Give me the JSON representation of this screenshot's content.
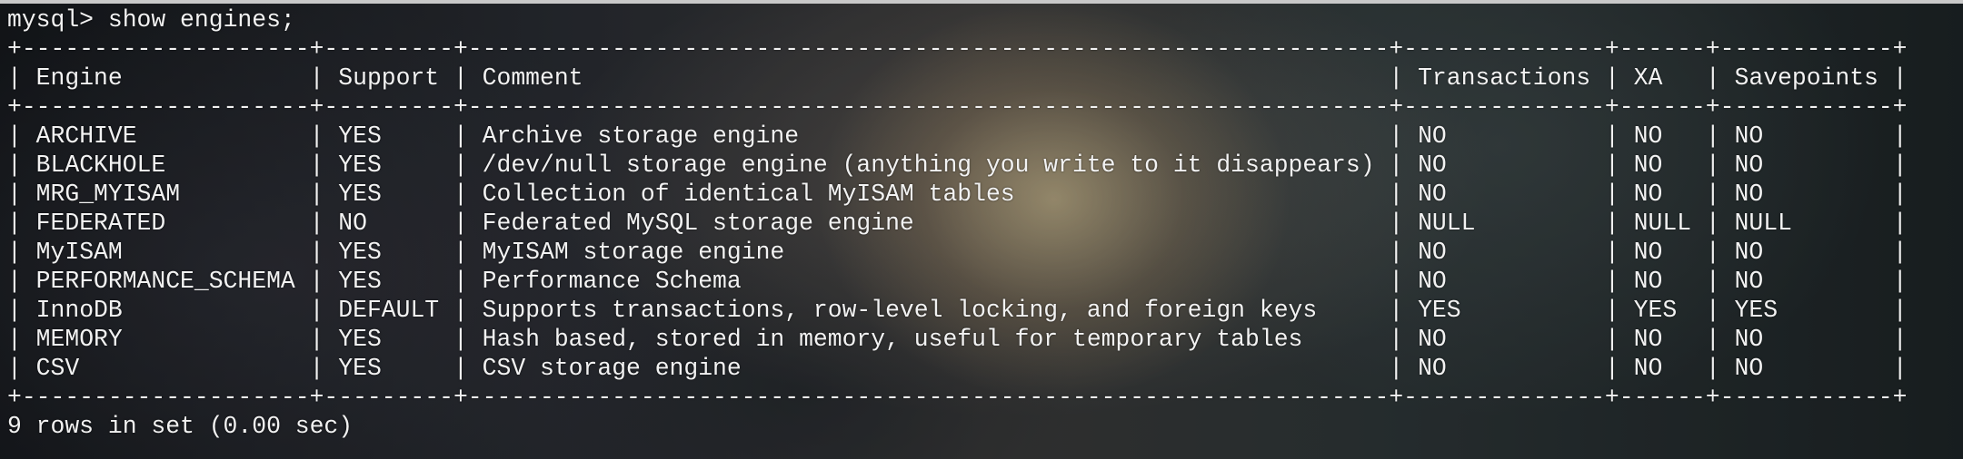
{
  "prompt": "mysql>",
  "command": "show engines;",
  "separator": "+--------------------+---------+----------------------------------------------------------------+--------------+------+------------+",
  "columns": [
    "Engine",
    "Support",
    "Comment",
    "Transactions",
    "XA",
    "Savepoints"
  ],
  "rows": [
    [
      "ARCHIVE",
      "YES",
      "Archive storage engine",
      "NO",
      "NO",
      "NO"
    ],
    [
      "BLACKHOLE",
      "YES",
      "/dev/null storage engine (anything you write to it disappears)",
      "NO",
      "NO",
      "NO"
    ],
    [
      "MRG_MYISAM",
      "YES",
      "Collection of identical MyISAM tables",
      "NO",
      "NO",
      "NO"
    ],
    [
      "FEDERATED",
      "NO",
      "Federated MySQL storage engine",
      "NULL",
      "NULL",
      "NULL"
    ],
    [
      "MyISAM",
      "YES",
      "MyISAM storage engine",
      "NO",
      "NO",
      "NO"
    ],
    [
      "PERFORMANCE_SCHEMA",
      "YES",
      "Performance Schema",
      "NO",
      "NO",
      "NO"
    ],
    [
      "InnoDB",
      "DEFAULT",
      "Supports transactions, row-level locking, and foreign keys",
      "YES",
      "YES",
      "YES"
    ],
    [
      "MEMORY",
      "YES",
      "Hash based, stored in memory, useful for temporary tables",
      "NO",
      "NO",
      "NO"
    ],
    [
      "CSV",
      "YES",
      "CSV storage engine",
      "NO",
      "NO",
      "NO"
    ]
  ],
  "footer": "9 rows in set (0.00 sec)"
}
